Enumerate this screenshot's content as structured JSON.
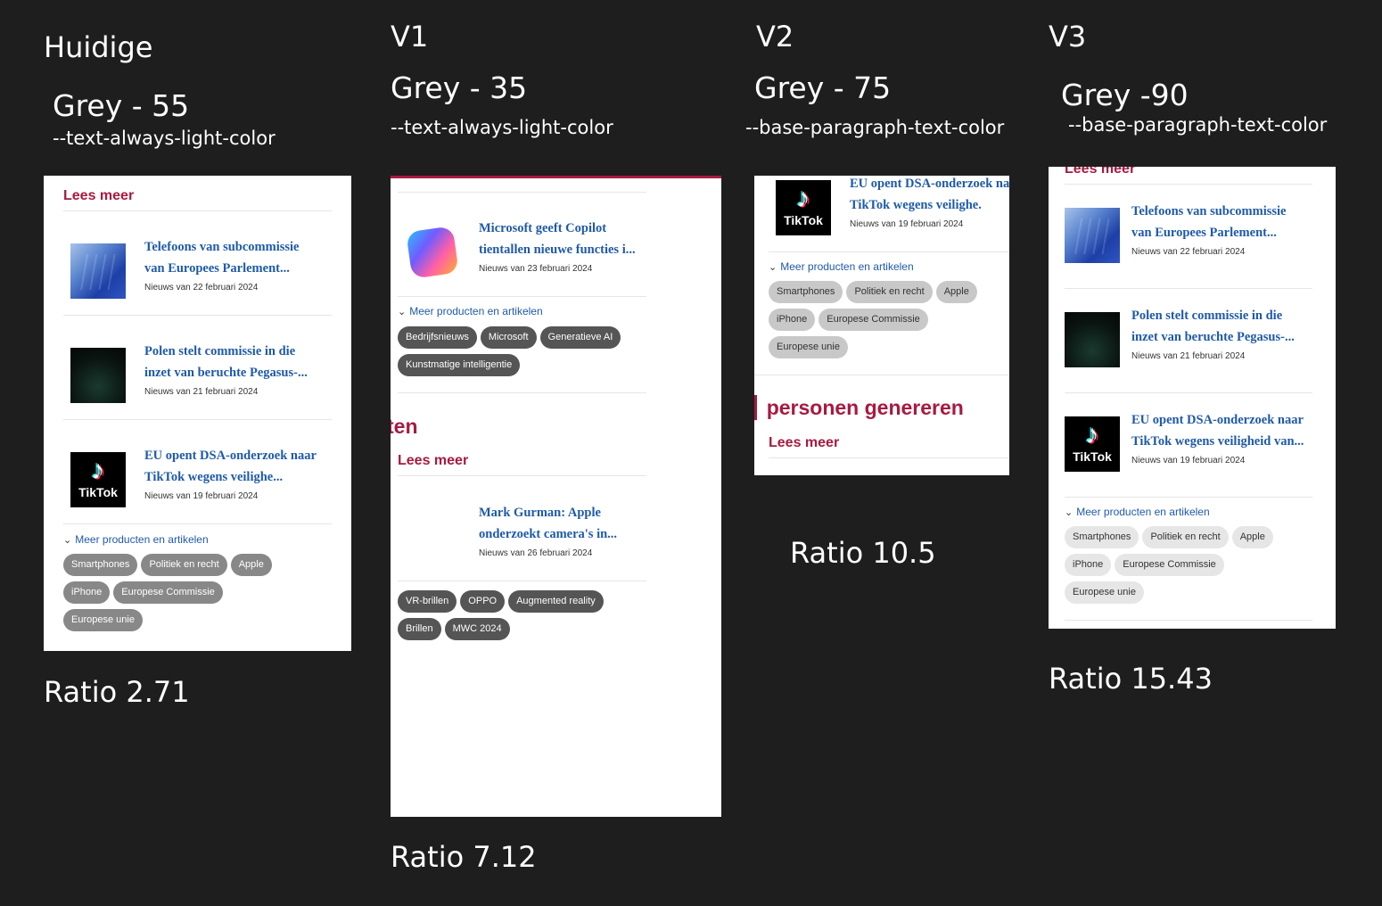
{
  "columns": [
    {
      "heading": "Huidige",
      "grey": "Grey - 55",
      "variable": "--text-always-light-color",
      "ratio": "Ratio 2.71"
    },
    {
      "heading": "V1",
      "grey": "Grey - 35",
      "variable": "--text-always-light-color",
      "ratio": "Ratio 7.12"
    },
    {
      "heading": "V2",
      "grey": "Grey - 75",
      "variable": "--base-paragraph-text-color",
      "ratio": "Ratio 10.5"
    },
    {
      "heading": "V3",
      "grey": "Grey -90",
      "variable": "--base-paragraph-text-color",
      "ratio": "Ratio 15.43"
    }
  ],
  "lees_meer": "Lees meer",
  "more_label": "Meer producten en artikelen",
  "articles": {
    "telefoons": {
      "title": "Telefoons van subcommissie van Europees Parlement...",
      "date": "Nieuws van 22 februari 2024",
      "thumb": "eu-flags-image"
    },
    "polen": {
      "title": "Polen stelt commissie in die inzet van beruchte Pegasus-...",
      "date": "Nieuws van 21 februari 2024",
      "thumb": "keyboard-image"
    },
    "tiktok": {
      "title": "EU opent DSA-onderzoek naar TikTok wegens veilighe...",
      "title_v3": "EU opent DSA-onderzoek naar TikTok wegens veiligheid van...",
      "title_v2": "EU opent DSA-onderzoek naar TikTok wegens veilighe.",
      "date": "Nieuws van 19 februari 2024",
      "thumb": "tiktok-logo",
      "logo_text": "TikTok"
    },
    "copilot": {
      "title": "Microsoft geeft Copilot tientallen nieuwe functies i...",
      "date": "Nieuws van 23 februari 2024",
      "thumb": "copilot-logo"
    },
    "apple": {
      "title": "Mark Gurman: Apple onderzoekt camera's in...",
      "date": "Nieuws van 26 februari 2024",
      "thumb": "apple-logo"
    }
  },
  "tags_default": [
    "Smartphones",
    "Politiek en recht",
    "Apple",
    "iPhone",
    "Europese Commissie",
    "Europese unie"
  ],
  "tags_v1_a": [
    "Bedrijfsnieuws",
    "Microsoft",
    "Generatieve AI",
    "Kunstmatige intelligentie"
  ],
  "tags_v1_b": [
    "VR-brillen",
    "OPPO",
    "Augmented reality",
    "Brillen",
    "MWC 2024"
  ],
  "v1_heading_fragment": "ten",
  "v2_heading_fragment": "personen genereren"
}
